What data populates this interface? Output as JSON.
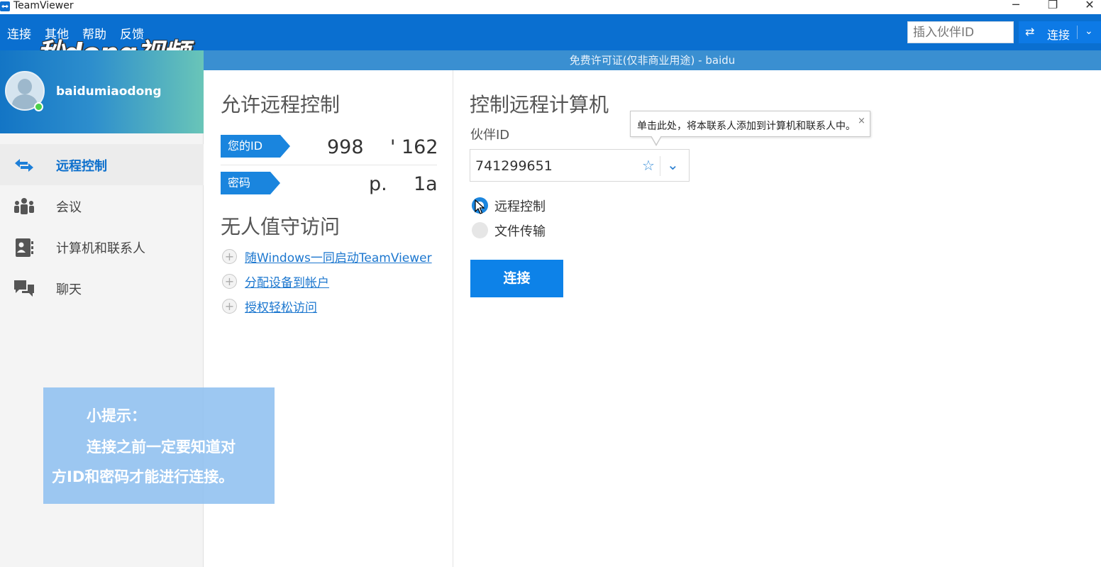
{
  "window": {
    "title": "TeamViewer",
    "min_glyph": "─",
    "max_glyph": "❐",
    "close_glyph": "✕"
  },
  "menu": {
    "items": [
      "连接",
      "其他",
      "帮助",
      "反馈"
    ]
  },
  "watermark": {
    "text": "秒dong视频"
  },
  "header": {
    "partner_placeholder": "插入伙伴ID",
    "connect_label": "连接",
    "connect_arrow": "⇄",
    "dropdown_glyph": "⌄"
  },
  "license": {
    "text": "免费许可证(仅非商业用途) - baidu"
  },
  "profile": {
    "username": "baidumiaodong",
    "status_color": "#4bd04a"
  },
  "sidebar": {
    "items": [
      {
        "label": "远程控制",
        "icon": "arrows-icon",
        "active": true
      },
      {
        "label": "会议",
        "icon": "meeting-people-icon",
        "active": false
      },
      {
        "label": "计算机和联系人",
        "icon": "contacts-book-icon",
        "active": false
      },
      {
        "label": "聊天",
        "icon": "chat-bubbles-icon",
        "active": false
      }
    ]
  },
  "tip": {
    "line1": "小提示：",
    "line2": "连接之前一定要知道对",
    "line3": "方ID和密码才能进行连接。"
  },
  "allow": {
    "title": "允许远程控制",
    "id_tag": "您的ID",
    "id_part1": "998",
    "id_part2": "' 162",
    "password_tag": "密码",
    "password_part1": "p.",
    "password_part2": "1a",
    "unattended_title": "无人值守访问",
    "links": [
      "随Windows一同启动TeamViewer",
      "分配设备到帐户",
      "授权轻松访问"
    ]
  },
  "control": {
    "title": "控制远程计算机",
    "partner_label": "伙伴ID",
    "partner_value": "741299651",
    "star_glyph": "☆",
    "chevron_glyph": "⌄",
    "options": [
      {
        "label": "远程控制",
        "selected": true
      },
      {
        "label": "文件传输",
        "selected": false
      }
    ],
    "connect_button": "连接"
  },
  "tooltip": {
    "text": "单击此处，将本联系人添加到计算机和联系人中。",
    "close_glyph": "×"
  },
  "colors": {
    "header_blue": "#0a6fd0",
    "license_bar": "#3a8fd1",
    "accent": "#0d82e8"
  }
}
